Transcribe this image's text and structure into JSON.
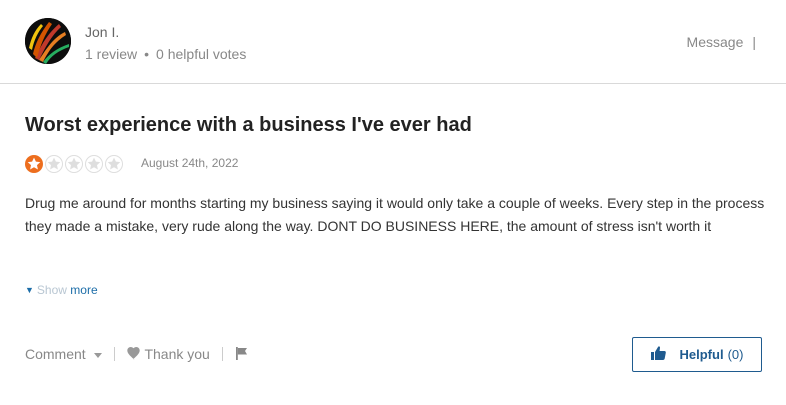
{
  "reviewer": {
    "name": "Jon I.",
    "review_count": "1 review",
    "helpful_votes": "0 helpful votes",
    "separator": "•"
  },
  "header_actions": {
    "message_label": "Message",
    "pipe": "|"
  },
  "review": {
    "title": "Worst experience with a business I've ever had",
    "rating": 1,
    "max_rating": 5,
    "date": "August 24th, 2022",
    "body": "Drug me around for months starting my business saying it would only take a couple of weeks. Every step in the process they made a mistake, very rude along the way. DONT DO BUSINESS HERE, the amount of stress isn't worth it",
    "show_more_prefix": "Show ",
    "show_more_suffix": "more"
  },
  "footer": {
    "comment_label": "Comment",
    "thank_you_label": "Thank you",
    "helpful_label": "Helpful",
    "helpful_count": "(0)"
  },
  "icons": {
    "star_filled": "star-icon",
    "star_empty": "star-empty-icon",
    "heart": "heart-icon",
    "flag": "flag-icon",
    "thumbs_up": "thumbs-up-icon",
    "caret": "caret-down-icon"
  },
  "colors": {
    "star_active": "#ed6e1e",
    "star_inactive": "#dedede",
    "link": "#1c6da8",
    "helpful_border": "#1f5b8f"
  }
}
